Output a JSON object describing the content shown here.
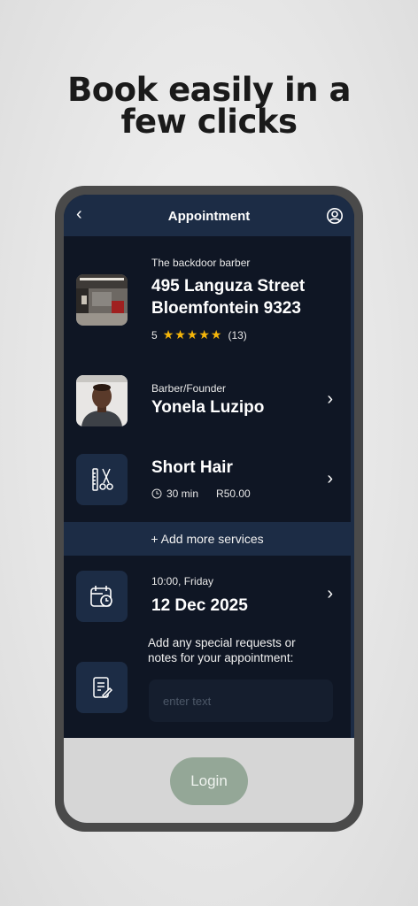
{
  "headline": {
    "line1": "Book easily in a",
    "line2": "few clicks"
  },
  "appbar": {
    "back_icon": "chevron-left-icon",
    "title": "Appointment",
    "profile_icon": "user-circle-icon"
  },
  "shop": {
    "name": "The backdoor barber",
    "address_line1": "495 Languza Street",
    "address_line2": "Bloemfontein 9323",
    "rating": "5",
    "stars": "★★★★★",
    "rating_count": "(13)",
    "star_color": "#f5b60a"
  },
  "barber": {
    "role": "Barber/Founder",
    "name": "Yonela Luzipo"
  },
  "service": {
    "icon": "comb-scissors-icon",
    "name": "Short Hair",
    "duration": "30 min",
    "price": "R50.00"
  },
  "add_services": {
    "label": "+ Add more services"
  },
  "datetime": {
    "icon": "calendar-clock-icon",
    "time_day": "10:00,  Friday",
    "date": "12 Dec 2025"
  },
  "notes": {
    "icon": "notepad-pen-icon",
    "label": "Add any special requests or notes for your appointment:",
    "placeholder": "enter text",
    "value": ""
  },
  "footer": {
    "login_label": "Login",
    "login_color": "#94a797"
  },
  "colors": {
    "screen_bg": "#0f1624",
    "card_bg": "#1c2c45",
    "footer_bg": "#d6d6d6"
  }
}
